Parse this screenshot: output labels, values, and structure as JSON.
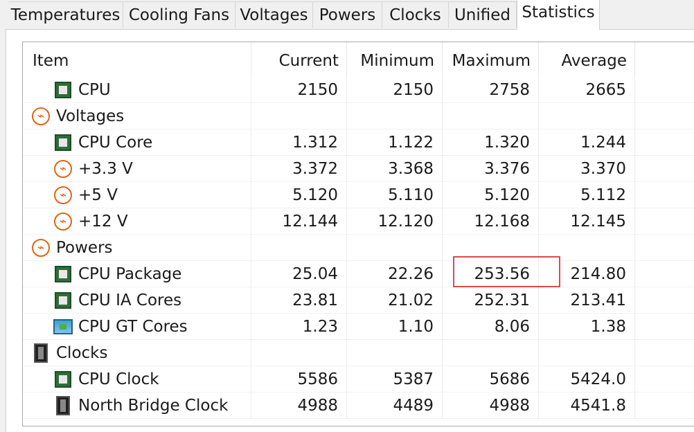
{
  "tabs": [
    {
      "label": "Temperatures",
      "active": false
    },
    {
      "label": "Cooling Fans",
      "active": false
    },
    {
      "label": "Voltages",
      "active": false
    },
    {
      "label": "Powers",
      "active": false
    },
    {
      "label": "Clocks",
      "active": false
    },
    {
      "label": "Unified",
      "active": false
    },
    {
      "label": "Statistics",
      "active": true
    }
  ],
  "columns": {
    "item": "Item",
    "current": "Current",
    "minimum": "Minimum",
    "maximum": "Maximum",
    "average": "Average"
  },
  "rows": [
    {
      "type": "child",
      "icon": "cpu-chip-icon",
      "label": "CPU",
      "current": "2150",
      "minimum": "2150",
      "maximum": "2758",
      "average": "2665"
    },
    {
      "type": "group",
      "icon": "voltage-bolt-icon",
      "label": "Voltages",
      "current": "",
      "minimum": "",
      "maximum": "",
      "average": ""
    },
    {
      "type": "child",
      "icon": "cpu-chip-icon",
      "label": "CPU Core",
      "current": "1.312",
      "minimum": "1.122",
      "maximum": "1.320",
      "average": "1.244"
    },
    {
      "type": "child",
      "icon": "voltage-bolt-icon",
      "label": "+3.3 V",
      "current": "3.372",
      "minimum": "3.368",
      "maximum": "3.376",
      "average": "3.370"
    },
    {
      "type": "child",
      "icon": "voltage-bolt-icon",
      "label": "+5 V",
      "current": "5.120",
      "minimum": "5.110",
      "maximum": "5.120",
      "average": "5.112"
    },
    {
      "type": "child",
      "icon": "voltage-bolt-icon",
      "label": "+12 V",
      "current": "12.144",
      "minimum": "12.120",
      "maximum": "12.168",
      "average": "12.145"
    },
    {
      "type": "group",
      "icon": "power-bolt-icon",
      "label": "Powers",
      "current": "",
      "minimum": "",
      "maximum": "",
      "average": ""
    },
    {
      "type": "child",
      "icon": "cpu-chip-icon",
      "label": "CPU Package",
      "current": "25.04",
      "minimum": "22.26",
      "maximum": "253.56",
      "average": "214.80"
    },
    {
      "type": "child",
      "icon": "cpu-chip-icon",
      "label": "CPU IA Cores",
      "current": "23.81",
      "minimum": "21.02",
      "maximum": "252.31",
      "average": "213.41"
    },
    {
      "type": "child",
      "icon": "gpu-monitor-icon",
      "label": "CPU GT Cores",
      "current": "1.23",
      "minimum": "1.10",
      "maximum": "8.06",
      "average": "1.38"
    },
    {
      "type": "group",
      "icon": "memory-module-icon",
      "label": "Clocks",
      "current": "",
      "minimum": "",
      "maximum": "",
      "average": ""
    },
    {
      "type": "child",
      "icon": "cpu-chip-icon",
      "label": "CPU Clock",
      "current": "5586",
      "minimum": "5387",
      "maximum": "5686",
      "average": "5424.0"
    },
    {
      "type": "child",
      "icon": "memory-module-icon",
      "label": "North Bridge Clock",
      "current": "4988",
      "minimum": "4489",
      "maximum": "4988",
      "average": "4541.8"
    }
  ],
  "colors": {
    "highlight": "#d94b4b",
    "bolt": "#e06418",
    "chip": "#2f6d3a"
  }
}
